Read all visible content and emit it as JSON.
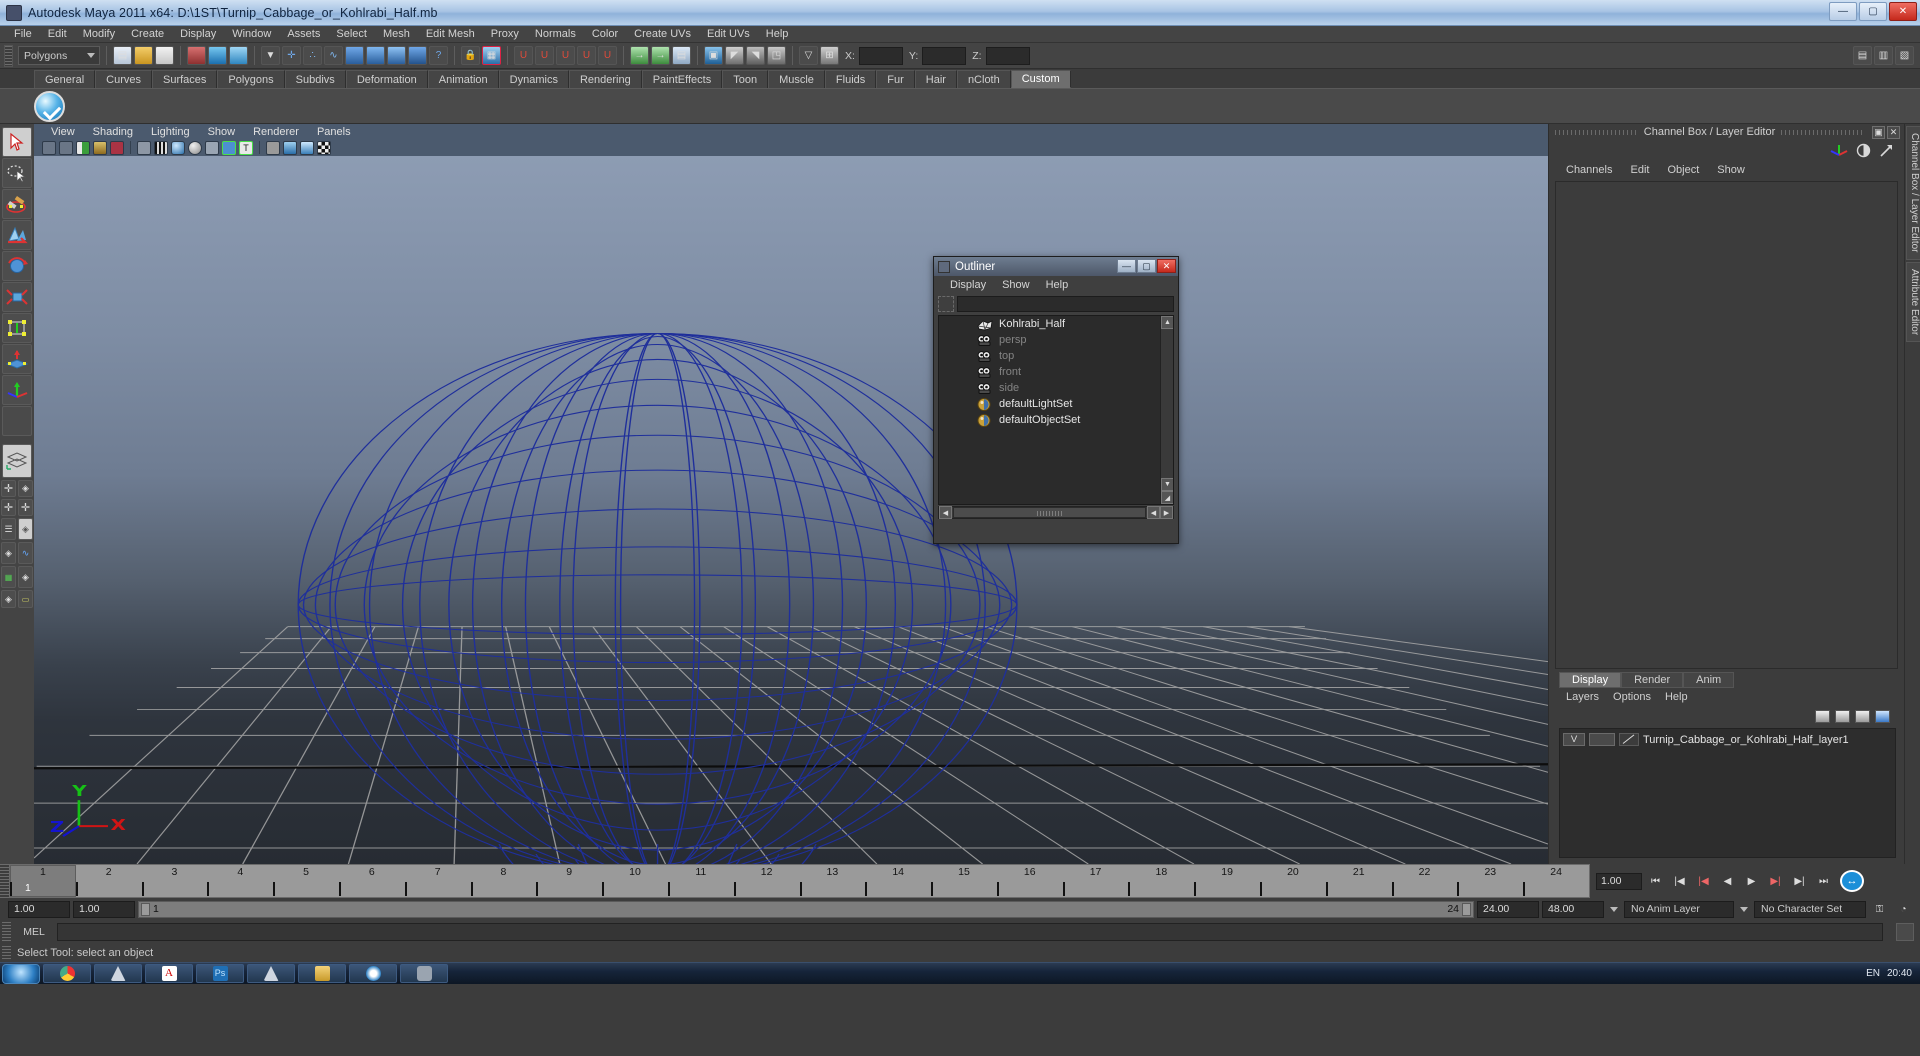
{
  "window": {
    "title": "Autodesk Maya 2011 x64: D:\\1ST\\Turnip_Cabbage_or_Kohlrabi_Half.mb",
    "icon": "maya-app-icon",
    "minimize": "—",
    "maximize": "▢",
    "close": "✕"
  },
  "menubar": {
    "items": [
      "File",
      "Edit",
      "Modify",
      "Create",
      "Display",
      "Window",
      "Assets",
      "Select",
      "Mesh",
      "Edit Mesh",
      "Proxy",
      "Normals",
      "Color",
      "Create UVs",
      "Edit UVs",
      "Help"
    ]
  },
  "statusline": {
    "mode_selected": "Polygons",
    "coord_labels": {
      "x": "X:",
      "y": "Y:",
      "z": "Z:"
    },
    "coord_values": {
      "x": "",
      "y": "",
      "z": ""
    }
  },
  "shelf": {
    "tabs": [
      "General",
      "Curves",
      "Surfaces",
      "Polygons",
      "Subdivs",
      "Deformation",
      "Animation",
      "Dynamics",
      "Rendering",
      "PaintEffects",
      "Toon",
      "Muscle",
      "Fluids",
      "Fur",
      "Hair",
      "nCloth",
      "Custom"
    ],
    "active_tab": "Custom",
    "items": [
      {
        "icon": "blue-check-sphere-icon"
      }
    ]
  },
  "toolbox": {
    "tools": [
      {
        "name": "select-tool",
        "selected": true
      },
      {
        "name": "lasso-select-tool",
        "selected": false
      },
      {
        "name": "paint-select-tool",
        "selected": false
      },
      {
        "name": "move-tool",
        "selected": false
      },
      {
        "name": "rotate-tool",
        "selected": false
      },
      {
        "name": "scale-tool",
        "selected": false
      },
      {
        "name": "universal-manipulator-tool",
        "selected": false
      },
      {
        "name": "soft-modification-tool",
        "selected": false
      },
      {
        "name": "show-manipulator-tool",
        "selected": false
      },
      {
        "name": "last-tool-used",
        "selected": false
      }
    ],
    "layouts": [
      "single-perspective-layout",
      "four-view-layout",
      "two-pane-layout",
      "outliner-persp-layout",
      "persp-graph-layout",
      "hypershade-persp-layout",
      "persp-render-layout"
    ]
  },
  "viewport": {
    "menu": [
      "View",
      "Shading",
      "Lighting",
      "Show",
      "Renderer",
      "Panels"
    ],
    "icons": [
      "select-camera-icon",
      "camera-attributes-icon",
      "book-icon",
      "paint-texture-icon",
      "keyframe-icon",
      "wireframe-shading-icon",
      "film-gate-icon",
      "smooth-shade-icon",
      "flat-shade-icon",
      "xray-icon",
      "lights-icon",
      "texture-icon",
      "grid-icon",
      "solid-cube-icon",
      "shaded-cube-icon",
      "checker-icon"
    ],
    "axis_gizmo": {
      "x": "X",
      "y": "Y",
      "z": "Z"
    },
    "colors": {
      "bg_top": "#8d9cb3",
      "bg_bottom": "#272c33",
      "wireframe": "#1f2f9b",
      "grid": "#9a9a9a",
      "axis_x": "#cc2222",
      "axis_y": "#22cc22",
      "axis_z": "#2222cc"
    }
  },
  "outliner": {
    "title": "Outliner",
    "menu": [
      "Display",
      "Show",
      "Help"
    ],
    "search_value": "",
    "window_buttons": {
      "minimize": "—",
      "maximize": "▢",
      "close": "✕"
    },
    "items": [
      {
        "label": "Kohlrabi_Half",
        "icon": "mesh-icon",
        "dim": false
      },
      {
        "label": "persp",
        "icon": "camera-icon",
        "dim": true
      },
      {
        "label": "top",
        "icon": "camera-icon",
        "dim": true
      },
      {
        "label": "front",
        "icon": "camera-icon",
        "dim": true
      },
      {
        "label": "side",
        "icon": "camera-icon",
        "dim": true
      },
      {
        "label": "defaultLightSet",
        "icon": "set-icon",
        "dim": false
      },
      {
        "label": "defaultObjectSet",
        "icon": "set-icon",
        "dim": false
      }
    ]
  },
  "channelbox": {
    "title": "Channel Box / Layer Editor",
    "menu": [
      "Channels",
      "Edit",
      "Object",
      "Show"
    ],
    "header_buttons": {
      "restore": "▣",
      "close": "✕"
    },
    "tool_icons": [
      "axis-icon",
      "half-circle-icon",
      "arrow-icon"
    ],
    "side_tabs": [
      "Channel Box / Layer Editor",
      "Attribute Editor"
    ]
  },
  "layereditor": {
    "tabs": [
      "Display",
      "Render",
      "Anim"
    ],
    "active_tab": "Display",
    "menu": [
      "Layers",
      "Options",
      "Help"
    ],
    "buttons": [
      "move-layer-up-icon",
      "move-layer-down-icon",
      "new-layer-icon",
      "new-layer-from-selected-icon"
    ],
    "layers": [
      {
        "visibility": "V",
        "state": "",
        "name": "Turnip_Cabbage_or_Kohlrabi_Half_layer1"
      }
    ]
  },
  "timeline": {
    "ticks": [
      "1",
      "2",
      "3",
      "4",
      "5",
      "6",
      "7",
      "8",
      "9",
      "10",
      "11",
      "12",
      "13",
      "14",
      "15",
      "16",
      "17",
      "18",
      "19",
      "20",
      "21",
      "22",
      "23",
      "24"
    ],
    "current_frame": "1",
    "current_frame_field": "1.00",
    "playback_buttons": [
      "go-to-start-icon",
      "step-back-frame-icon",
      "step-back-key-icon",
      "play-backwards-icon",
      "play-forwards-icon",
      "step-forward-key-icon",
      "step-forward-frame-icon",
      "go-to-end-icon"
    ],
    "auto_key": "auto-keyframe-icon"
  },
  "rangeslider": {
    "start_field": "1.00",
    "end_field": "1.00",
    "range_start": "1",
    "range_end": "24",
    "playback_start_field": "24.00",
    "playback_end_field": "48.00",
    "anim_layer": "No Anim Layer",
    "character_set": "No Character Set"
  },
  "commandline": {
    "label": "MEL",
    "value": ""
  },
  "helpline": {
    "text": "Select Tool: select an object"
  },
  "taskbar": {
    "start": "start-orb",
    "items": [
      "chrome-icon",
      "maya-icon",
      "acrobat-icon",
      "photoshop-icon",
      "maya2-icon",
      "folder-icon",
      "opera-icon",
      "sketch-icon"
    ],
    "tray": {
      "lang": "EN",
      "time": "20:40"
    }
  }
}
